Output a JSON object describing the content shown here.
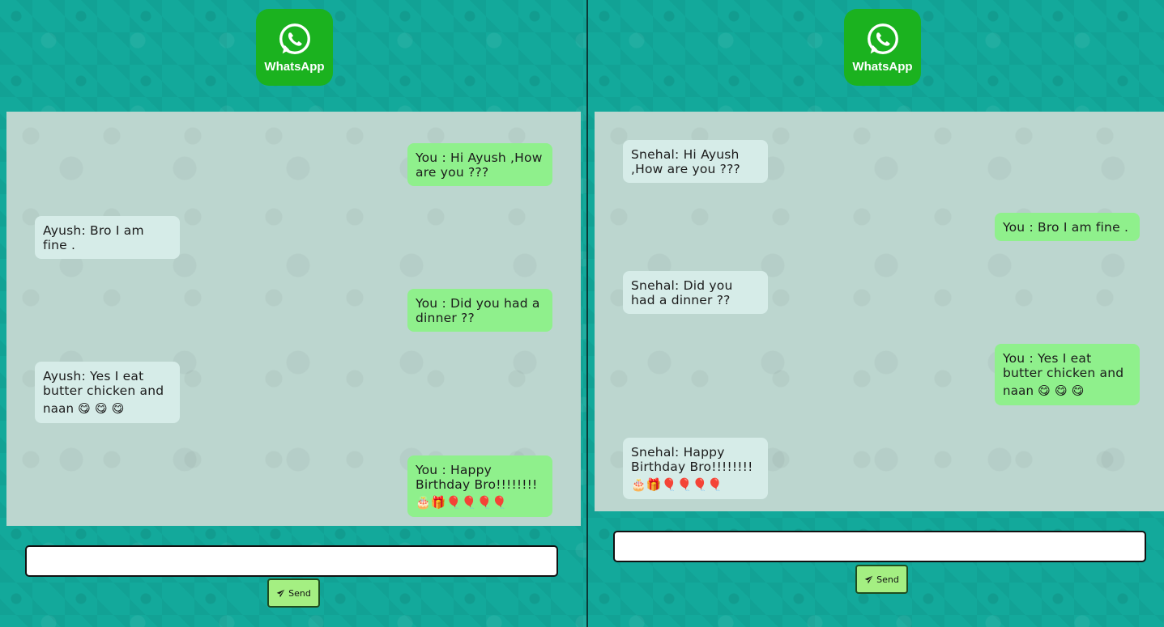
{
  "logo_text": "WhatsApp",
  "send_label": "Send",
  "input_value": "",
  "colors": {
    "background": "#13a99b",
    "logo_green": "#1bb21f",
    "incoming_bubble": "#d6ece8",
    "outgoing_bubble": "#8ff08c",
    "send_button": "#a4ef82"
  },
  "icons": {
    "logo": "whatsapp-phone-icon",
    "send": "paper-plane-icon"
  },
  "left_chat": {
    "messages": [
      {
        "direction": "out",
        "text": "You : Hi Ayush ,How are you ???",
        "emoji": ""
      },
      {
        "direction": "in",
        "text": "Ayush: Bro I am fine .",
        "emoji": ""
      },
      {
        "direction": "out",
        "text": "You : Did you had a dinner ??",
        "emoji": ""
      },
      {
        "direction": "in",
        "text": "Ayush: Yes I eat butter chicken and",
        "emoji": "naan 😋 😋 😋"
      },
      {
        "direction": "out",
        "text": "You : Happy Birthday Bro!!!!!!!!",
        "emoji": "🎂🎁🎈🎈🎈🎈"
      }
    ]
  },
  "right_chat": {
    "messages": [
      {
        "direction": "in",
        "text": "Snehal: Hi Ayush ,How are you ???",
        "emoji": ""
      },
      {
        "direction": "out",
        "text": "You : Bro I am fine .",
        "emoji": ""
      },
      {
        "direction": "in",
        "text": "Snehal: Did you had a dinner ??",
        "emoji": ""
      },
      {
        "direction": "out",
        "text": "You : Yes I eat butter chicken and",
        "emoji": "naan 😋 😋 😋"
      },
      {
        "direction": "in",
        "text": "Snehal: Happy Birthday Bro!!!!!!!!",
        "emoji": "🎂🎁🎈🎈🎈🎈"
      }
    ]
  }
}
